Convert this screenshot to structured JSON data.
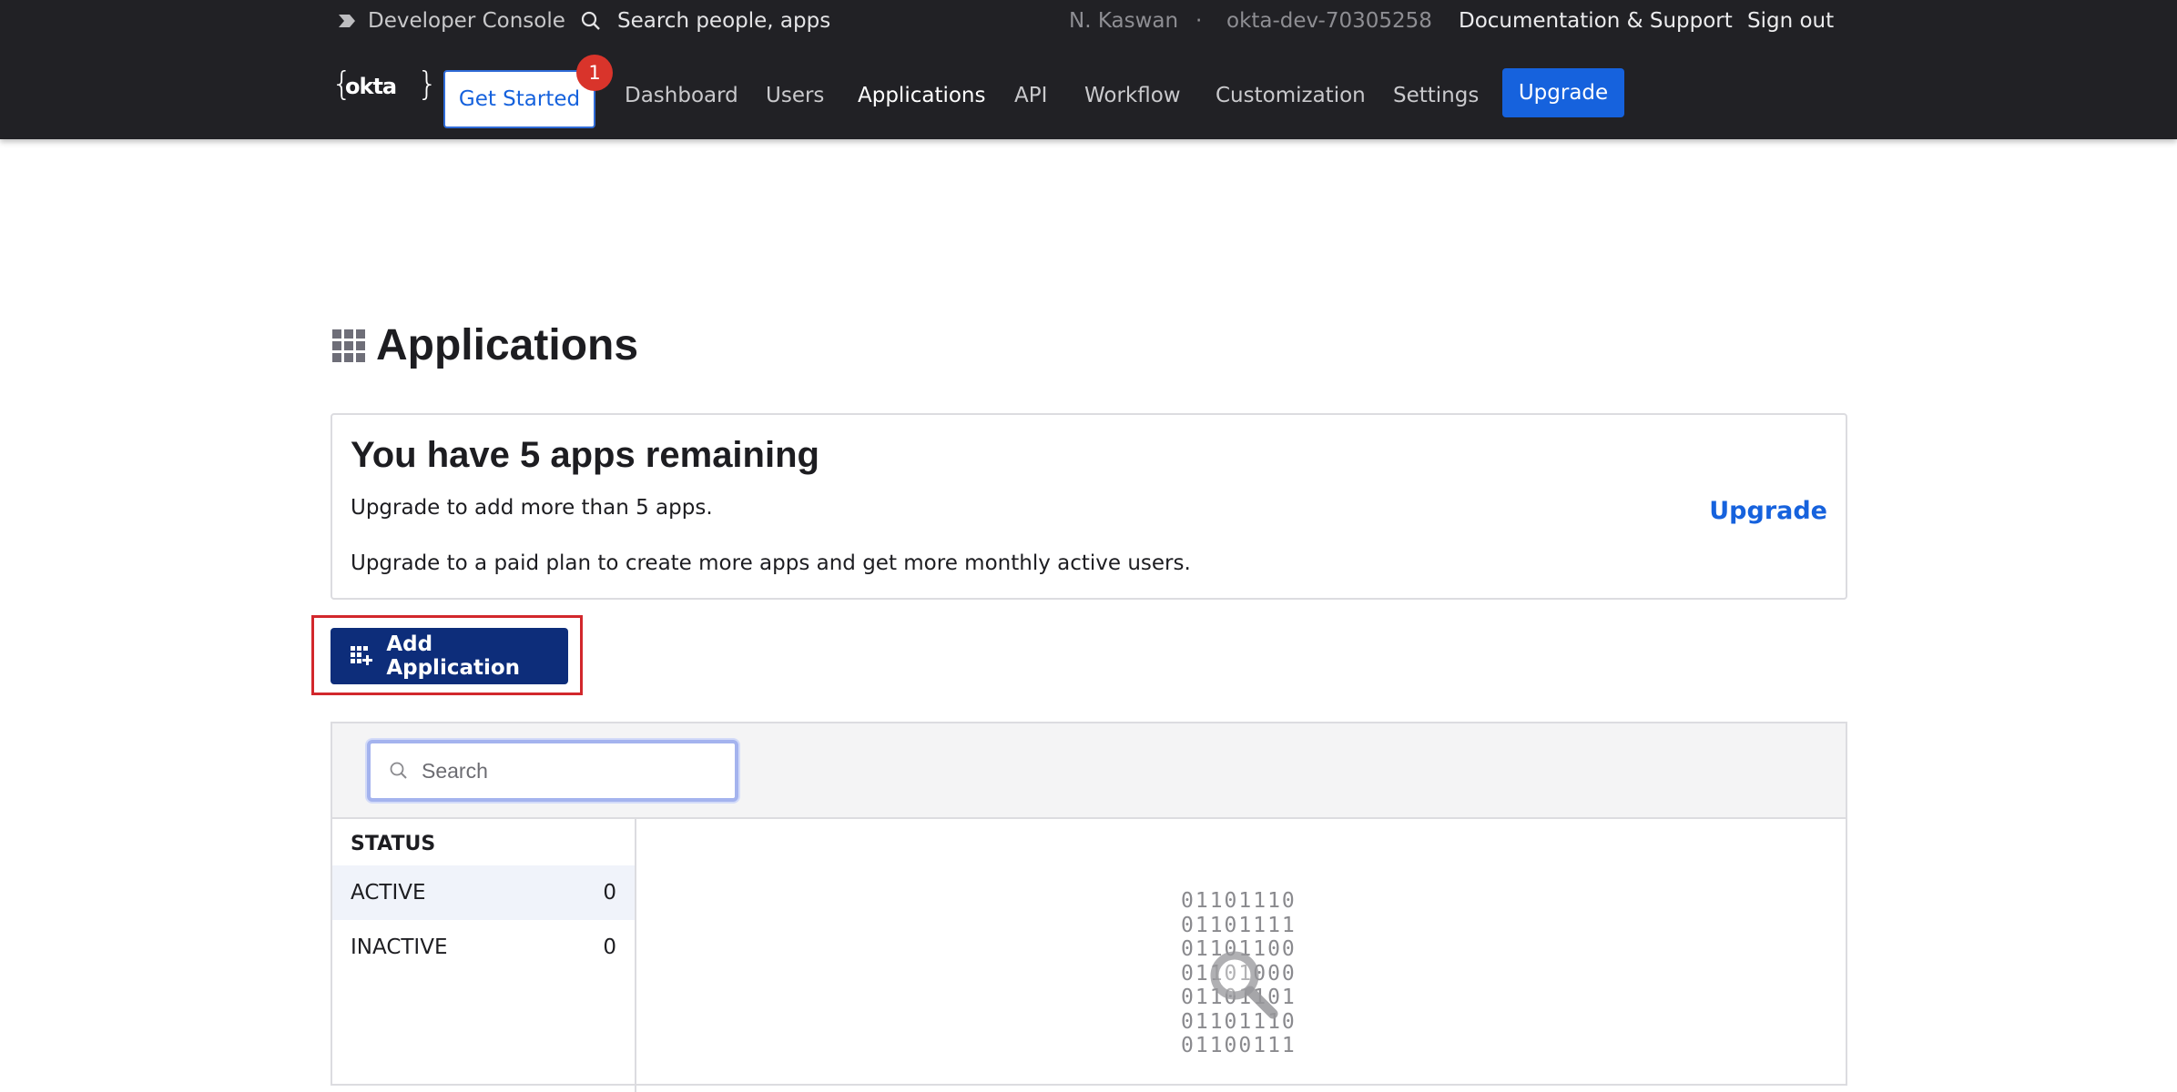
{
  "header": {
    "console_label": "Developer Console",
    "search_placeholder": "Search people, apps",
    "user_name": "N. Kaswan",
    "separator": "·",
    "org_name": "okta-dev-70305258",
    "docs_link": "Documentation & Support",
    "signout_link": "Sign out",
    "logo_text": "okta",
    "get_started_label": "Get Started",
    "get_started_badge": "1",
    "nav": {
      "dashboard": "Dashboard",
      "users": "Users",
      "applications": "Applications",
      "api": "API",
      "workflow": "Workflow",
      "customization": "Customization",
      "settings": "Settings"
    },
    "upgrade_button": "Upgrade"
  },
  "page": {
    "title": "Applications",
    "remaining_title": "You have 5 apps remaining",
    "remaining_line1": "Upgrade to add more than 5 apps.",
    "remaining_line2": "Upgrade to a paid plan to create more apps and get more monthly active users.",
    "upgrade_link": "Upgrade",
    "add_application_label": "Add Application"
  },
  "table": {
    "search_placeholder": "Search",
    "status_header": "STATUS",
    "status_rows": [
      {
        "label": "ACTIVE",
        "count": "0"
      },
      {
        "label": "INACTIVE",
        "count": "0"
      }
    ],
    "empty_binary": [
      "01101110",
      "01101111",
      "01101100",
      "01101000",
      "01101101",
      "01101110",
      "01100111"
    ]
  },
  "colors": {
    "topbar_bg": "#212125",
    "accent_blue": "#1662dd",
    "add_button_bg": "#0d2d7a",
    "badge_red": "#d9342b",
    "highlight_red": "#d2272c"
  }
}
